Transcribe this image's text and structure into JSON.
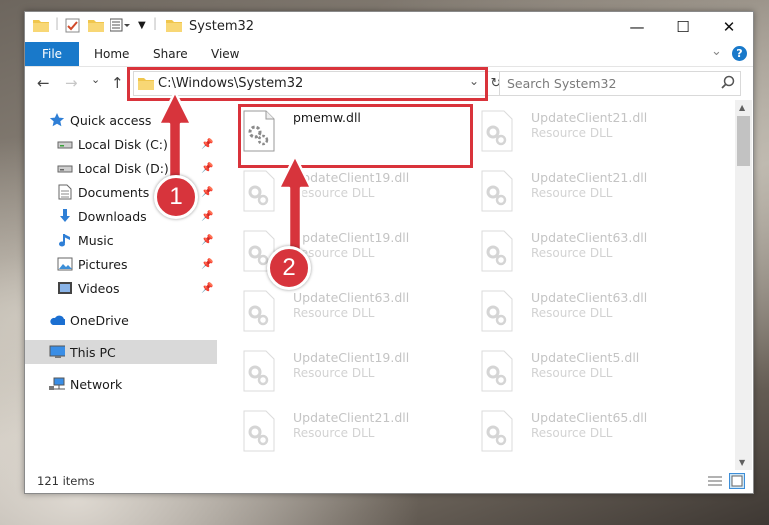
{
  "window": {
    "title": "System32",
    "controls": {
      "minimize": "—",
      "maximize": "☐",
      "close": "✕"
    }
  },
  "ribbon": {
    "tabs": [
      "File",
      "Home",
      "Share",
      "View"
    ],
    "expand_glyph": "⌄",
    "help_glyph": "?"
  },
  "nav": {
    "back": "←",
    "forward": "→",
    "recent": "⌄",
    "up": "↑",
    "address": "C:\\Windows\\System32",
    "address_dropdown": "⌄",
    "refresh": "↻",
    "search_placeholder": "Search System32"
  },
  "sidebar": {
    "quick_access": "Quick access",
    "items": [
      {
        "label": "Local Disk (C:)",
        "icon": "drive-icon"
      },
      {
        "label": "Local Disk (D:)",
        "icon": "drive-icon"
      },
      {
        "label": "Documents",
        "icon": "documents-icon"
      },
      {
        "label": "Downloads",
        "icon": "downloads-icon"
      },
      {
        "label": "Music",
        "icon": "music-icon"
      },
      {
        "label": "Pictures",
        "icon": "pictures-icon"
      },
      {
        "label": "Videos",
        "icon": "videos-icon"
      }
    ],
    "onedrive": "OneDrive",
    "this_pc": "This PC",
    "network": "Network"
  },
  "files": [
    {
      "name": "pmemw.dll",
      "type": "",
      "highlighted": true
    },
    {
      "name": "UpdateClient21.dll",
      "type": "Resource DLL"
    },
    {
      "name": "UpdateClient19.dll",
      "type": "Resource DLL"
    },
    {
      "name": "UpdateClient21.dll",
      "type": "Resource DLL"
    },
    {
      "name": "UpdateClient19.dll",
      "type": "Resource DLL"
    },
    {
      "name": "UpdateClient63.dll",
      "type": "Resource DLL"
    },
    {
      "name": "UpdateClient63.dll",
      "type": "Resource DLL"
    },
    {
      "name": "UpdateClient63.dll",
      "type": "Resource DLL"
    },
    {
      "name": "UpdateClient19.dll",
      "type": "Resource DLL"
    },
    {
      "name": "UpdateClient5.dll",
      "type": "Resource DLL"
    },
    {
      "name": "UpdateClient21.dll",
      "type": "Resource DLL"
    },
    {
      "name": "UpdateClient65.dll",
      "type": "Resource DLL"
    }
  ],
  "status": {
    "item_count": "121 items"
  },
  "callouts": {
    "one": "1",
    "two": "2"
  },
  "colors": {
    "accent": "#1979ca",
    "highlight_box": "#d9333b",
    "callout": "#d7343c"
  }
}
